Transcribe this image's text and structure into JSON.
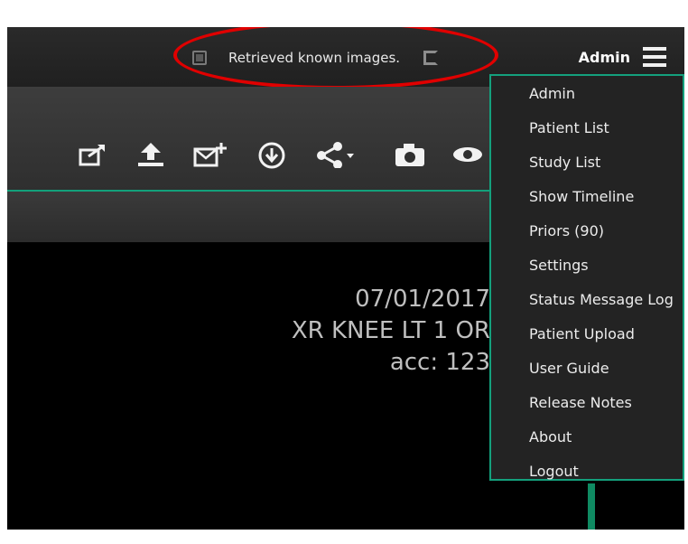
{
  "topbar": {
    "status_message": "Retrieved known images.",
    "user": "Admin"
  },
  "overlay": {
    "lines": [
      "07/01/2017",
      "XR KNEE LT 1 OR",
      "acc: 123"
    ]
  },
  "menu": {
    "items": [
      {
        "label": "Admin"
      },
      {
        "label": "Patient List"
      },
      {
        "label": "Study List"
      },
      {
        "label": "Show Timeline"
      },
      {
        "label": "Priors (90)"
      },
      {
        "label": "Settings"
      },
      {
        "label": "Status Message Log"
      },
      {
        "label": "Patient Upload"
      },
      {
        "label": "User Guide"
      },
      {
        "label": "Release Notes"
      },
      {
        "label": "About"
      },
      {
        "label": "Logout"
      }
    ]
  },
  "toolbar": {
    "icons": [
      "export-icon",
      "upload-icon",
      "email-icon",
      "download-icon",
      "share-icon",
      "camera-icon",
      "eye-icon"
    ]
  },
  "colors": {
    "accent": "#14a07d",
    "highlight": "#e00000"
  }
}
